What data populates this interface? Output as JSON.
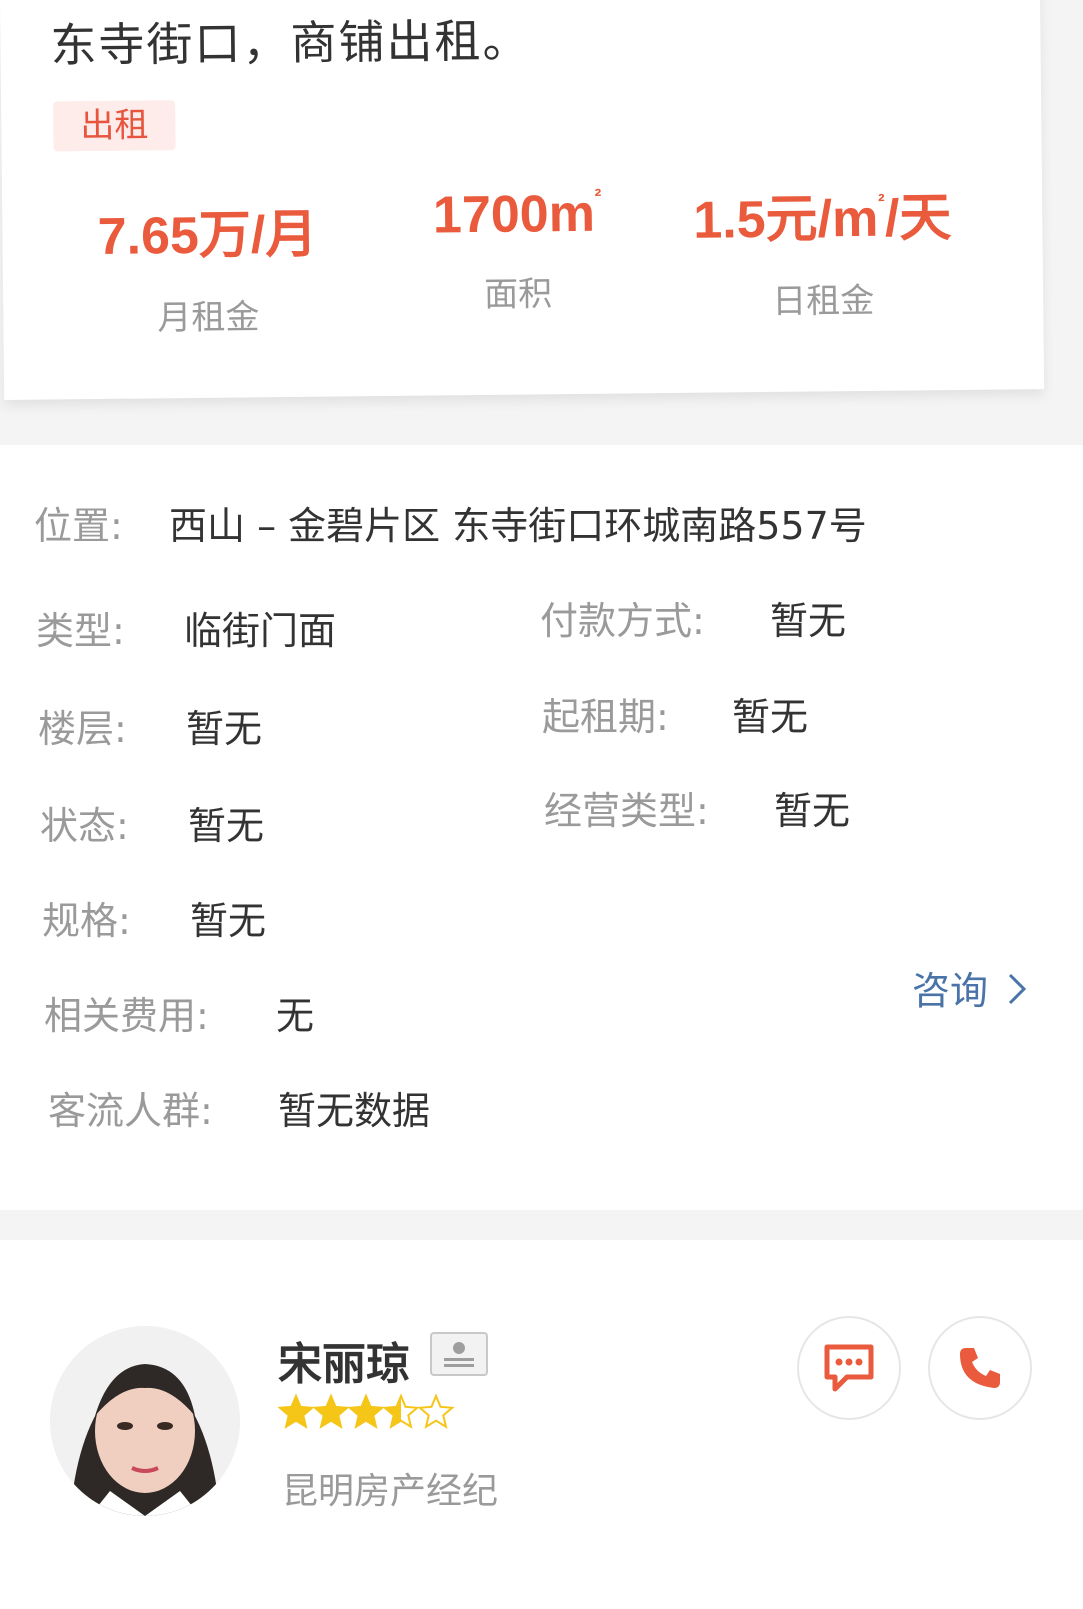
{
  "listing": {
    "title": "东寺街口，商铺出租。",
    "tag": "出租",
    "stats": [
      {
        "value": "7.65万/月",
        "label": "月租金"
      },
      {
        "value": "1700m",
        "sup": "²",
        "label": "面积"
      },
      {
        "value_pre": "1.5元/m",
        "sup": "²",
        "value_post": "/天",
        "label": "日租金"
      }
    ]
  },
  "details": {
    "location_label": "位置:",
    "location_value": "西山 – 金碧片区 东寺街口环城南路557号",
    "type_label": "类型:",
    "type_value": "临街门面",
    "payment_label": "付款方式:",
    "payment_value": "暂无",
    "floor_label": "楼层:",
    "floor_value": "暂无",
    "lease_label": "起租期:",
    "lease_value": "暂无",
    "status_label": "状态:",
    "status_value": "暂无",
    "business_label": "经营类型:",
    "business_value": "暂无",
    "spec_label": "规格:",
    "spec_value": "暂无",
    "fees_label": "相关费用:",
    "fees_value": "无",
    "crowd_label": "客流人群:",
    "crowd_value": "暂无数据",
    "consult_label": "咨询",
    "consult_icon": "chevron-right-icon"
  },
  "agent": {
    "name": "宋丽琼",
    "rating": 3.5,
    "company": "昆明房产经纪",
    "badge_icon": "id-card-icon",
    "chat_icon": "chat-bubble-icon",
    "phone_icon": "phone-icon"
  },
  "colors": {
    "accent": "#ea5a3c",
    "link": "#4a73a8",
    "muted": "#9a9a9a",
    "star": "#f5c518"
  }
}
